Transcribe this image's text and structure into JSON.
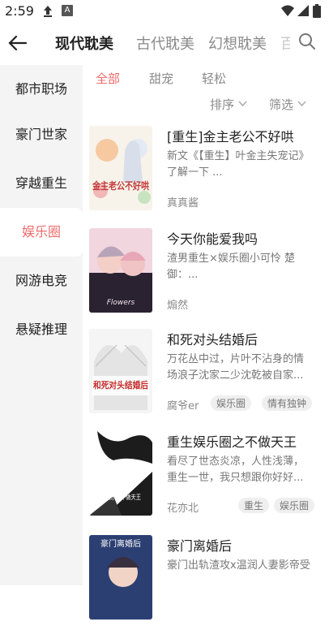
{
  "status": {
    "time": "2:59",
    "a_badge": "A"
  },
  "tabs": [
    "现代耽美",
    "古代耽美",
    "幻想耽美",
    "百"
  ],
  "sidebar": [
    "都市职场",
    "豪门世家",
    "穿越重生",
    "娱乐圈",
    "网游电竞",
    "悬疑推理"
  ],
  "filters": [
    "全部",
    "甜宠",
    "轻松"
  ],
  "sort": {
    "sort_label": "排序",
    "filter_label": "筛选"
  },
  "books": [
    {
      "title": "[重生]金主老公不好哄",
      "desc": "新文《【重生】叶金主失宠记》了解一下 ...",
      "author": "真真酱",
      "tags": [],
      "cover_text": "金主老公不好哄"
    },
    {
      "title": "今天你能爱我吗",
      "desc": "渣男重生×娱乐圈小可怜 楚御：...",
      "author": "煽然",
      "tags": [],
      "cover_text": "Flowers"
    },
    {
      "title": "和死对头结婚后",
      "desc": "万花丛中过，片叶不沾身的情场浪子沈家二少沈乾被自家...",
      "author": "腐爷er",
      "tags": [
        "娱乐圈",
        "情有独钟"
      ],
      "cover_text": "和死对头结婚后"
    },
    {
      "title": "重生娱乐圈之不做天王",
      "desc": "看尽了世态炎凉，人性浅薄，重生一世，我只想跟你好好...",
      "author": "花亦北",
      "tags": [
        "重生",
        "娱乐圈"
      ],
      "cover_text": "重生娱乐之不做天王"
    },
    {
      "title": "豪门离婚后",
      "desc": "豪门出轨渣攻x温润人妻影帝受",
      "author": "",
      "tags": [],
      "cover_text": "豪门离婚后"
    }
  ],
  "colors": {
    "accent": "#f06b6b",
    "sidebar_bg": "#f4f4f4"
  }
}
